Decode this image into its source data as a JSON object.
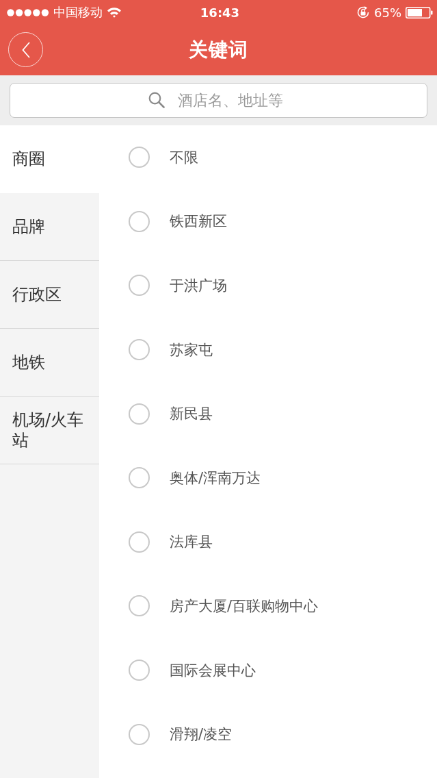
{
  "status_bar": {
    "carrier": "中国移动",
    "time": "16:43",
    "battery": "65%"
  },
  "nav": {
    "title": "关键词"
  },
  "search": {
    "placeholder": "酒店名、地址等"
  },
  "categories": [
    {
      "label": "商圈",
      "selected": true
    },
    {
      "label": "品牌",
      "selected": false
    },
    {
      "label": "行政区",
      "selected": false
    },
    {
      "label": "地铁",
      "selected": false
    },
    {
      "label": "机场/火车站",
      "selected": false
    }
  ],
  "options": [
    {
      "label": "不限",
      "selected": false
    },
    {
      "label": "铁西新区",
      "selected": false
    },
    {
      "label": "于洪广场",
      "selected": false
    },
    {
      "label": "苏家屯",
      "selected": false
    },
    {
      "label": "新民县",
      "selected": false
    },
    {
      "label": "奥体/浑南万达",
      "selected": false
    },
    {
      "label": "法库县",
      "selected": false
    },
    {
      "label": "房产大厦/百联购物中心",
      "selected": false
    },
    {
      "label": "国际会展中心",
      "selected": false
    },
    {
      "label": "滑翔/凌空",
      "selected": false
    }
  ]
}
